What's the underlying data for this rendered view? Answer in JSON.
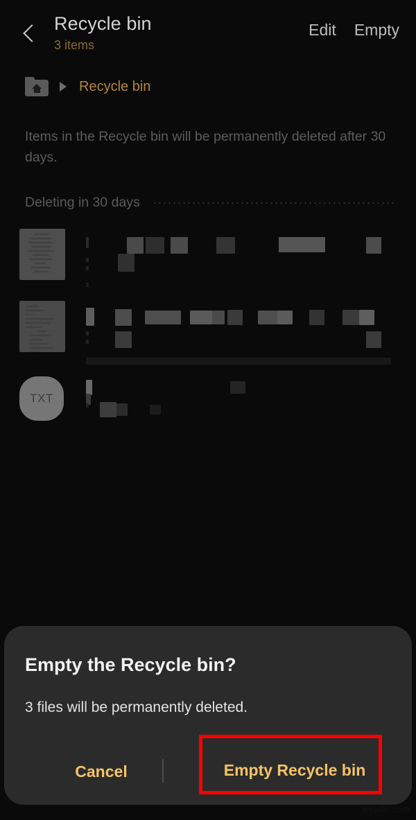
{
  "header": {
    "back_icon": "chevron-left-icon",
    "title": "Recycle bin",
    "subtitle": "3 items",
    "edit_label": "Edit",
    "empty_label": "Empty"
  },
  "breadcrumb": {
    "home_icon": "folder-home-icon",
    "separator_icon": "triangle-right-icon",
    "current": "Recycle bin"
  },
  "info": {
    "text": "Items in the Recycle bin will be permanently deleted after 30 days."
  },
  "section": {
    "label": "Deleting in 30 days"
  },
  "files": [
    {
      "icon": "document-thumbnail",
      "name_redacted": true,
      "name": ""
    },
    {
      "icon": "document-thumbnail",
      "name_redacted": true,
      "name": ""
    },
    {
      "icon": "txt-file-icon",
      "icon_label": "TXT",
      "name_redacted": true,
      "name": ""
    }
  ],
  "dialog": {
    "title": "Empty the Recycle bin?",
    "message": "3 files will be permanently deleted.",
    "cancel_label": "Cancel",
    "confirm_label": "Empty Recycle bin"
  },
  "colors": {
    "accent_amber": "#f5c368",
    "breadcrumb_amber": "#b8853a",
    "subtitle_amber": "#8a6a32",
    "dialog_bg": "#2b2b2b",
    "page_bg": "#0a0a0a",
    "highlight_red": "#ff0000"
  },
  "watermark": {
    "text": "wsxdn.com"
  }
}
